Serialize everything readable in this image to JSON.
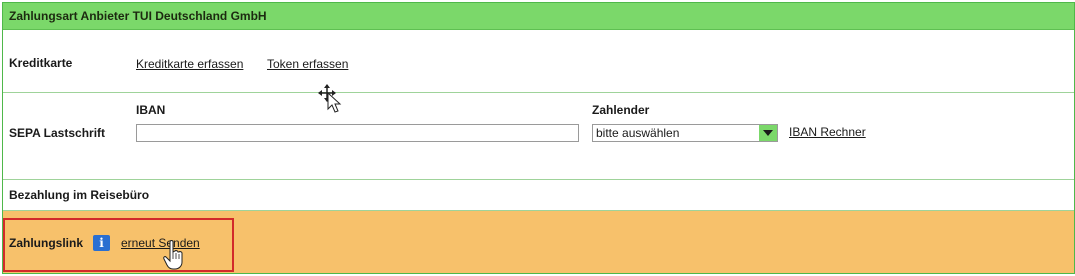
{
  "header": {
    "title": "Zahlungsart Anbieter TUI Deutschland GmbH"
  },
  "kreditkarte": {
    "label": "Kreditkarte",
    "link1": "Kreditkarte erfassen",
    "link2": "Token erfassen"
  },
  "sepa": {
    "label": "SEPA Lastschrift",
    "iban_label": "IBAN",
    "iban_value": "",
    "zahlender_label": "Zahlender",
    "zahlender_selected": "bitte auswählen",
    "iban_rechner": "IBAN Rechner"
  },
  "reisebuero": {
    "label": "Bezahlung im Reisebüro"
  },
  "zahlungslink": {
    "label": "Zahlungslink",
    "info_icon": "info-icon",
    "resend": "erneut Senden"
  },
  "colors": {
    "header_green": "#7bd86a",
    "border_green": "#4fb84a",
    "highlight_red": "#d22a2a",
    "orange_row": "#f7c16b",
    "info_blue": "#2a6fd1"
  }
}
